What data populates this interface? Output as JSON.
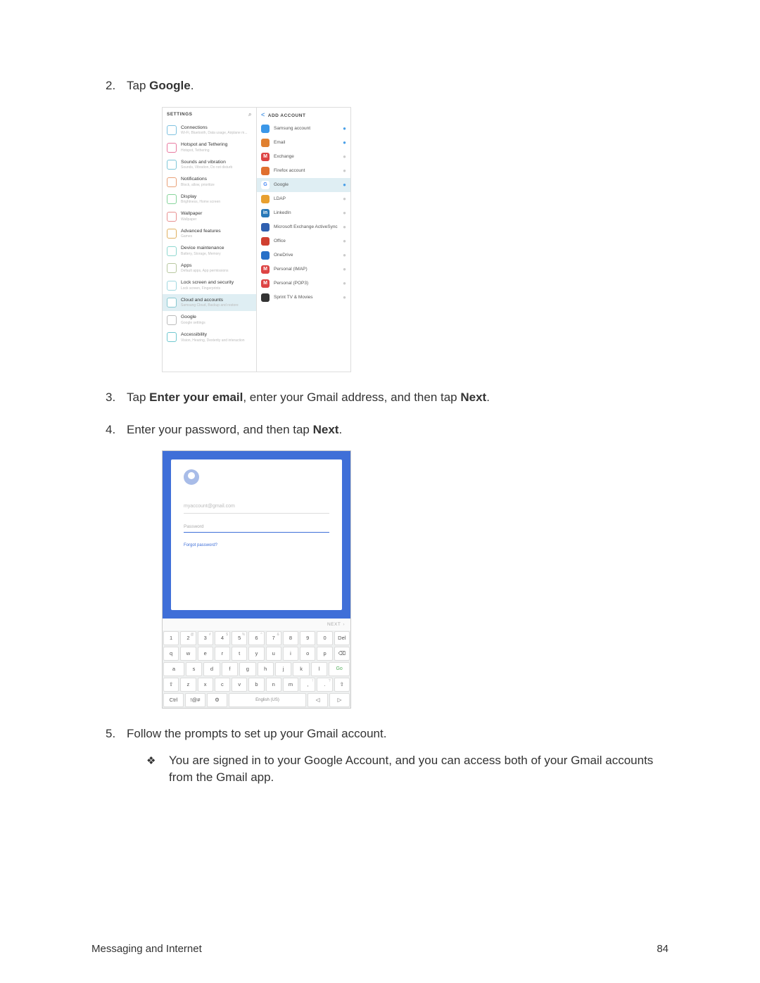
{
  "steps": {
    "s2": {
      "num": "2.",
      "pre": "Tap ",
      "bold": "Google",
      "post": "."
    },
    "s3": {
      "num": "3.",
      "pre": "Tap ",
      "b1": "Enter your email",
      "mid": ", enter your Gmail address, and then tap ",
      "b2": "Next",
      "post": "."
    },
    "s4": {
      "num": "4.",
      "pre": "Enter your password, and then tap ",
      "b1": "Next",
      "post": "."
    },
    "s5": {
      "num": "5.",
      "text": "Follow the prompts to set up your Gmail account."
    },
    "s5sub": "You are signed in to your Google Account, and you can access both of your Gmail accounts from the Gmail app."
  },
  "settings_left": {
    "title": "SETTINGS",
    "items": [
      {
        "t": "Connections",
        "s": "Wi-Fi, Bluetooth, Data usage, Airplane m...",
        "c": "#7fc2e0"
      },
      {
        "t": "Hotspot and Tethering",
        "s": "Hotspot, Tethering",
        "c": "#e97aa0"
      },
      {
        "t": "Sounds and vibration",
        "s": "Sounds, Vibration, Do not disturb",
        "c": "#7fc7d8"
      },
      {
        "t": "Notifications",
        "s": "Block, allow, prioritize",
        "c": "#e8a078"
      },
      {
        "t": "Display",
        "s": "Brightness, Home screen",
        "c": "#86d49b"
      },
      {
        "t": "Wallpaper",
        "s": "Wallpaper",
        "c": "#e89090"
      },
      {
        "t": "Advanced features",
        "s": "Games",
        "c": "#e0b060"
      },
      {
        "t": "Device maintenance",
        "s": "Battery, Storage, Memory",
        "c": "#8fd8d0"
      },
      {
        "t": "Apps",
        "s": "Default apps, App permissions",
        "c": "#b8c8a0"
      },
      {
        "t": "Lock screen and security",
        "s": "Lock screen, Fingerprints",
        "c": "#a0d8e0"
      },
      {
        "t": "Cloud and accounts",
        "s": "Samsung Cloud, Backup and restore",
        "c": "#88c8d0",
        "sel": true
      },
      {
        "t": "Google",
        "s": "Google settings",
        "c": "#bbb"
      },
      {
        "t": "Accessibility",
        "s": "Vision, Hearing, Dexterity and interaction",
        "c": "#70c8d0"
      }
    ]
  },
  "settings_right": {
    "title": "ADD ACCOUNT",
    "items": [
      {
        "t": "Samsung account",
        "c": "#3b97e8",
        "dot": "#4aa0e8"
      },
      {
        "t": "Email",
        "c": "#e08030",
        "dot": "#4aa0e8"
      },
      {
        "t": "Exchange",
        "c": "#d44",
        "dot": "#ccc",
        "g": "M"
      },
      {
        "t": "Firefox account",
        "c": "#e07030",
        "dot": "#ccc"
      },
      {
        "t": "Google",
        "c": "#fff",
        "dot": "#4aa0e8",
        "g": "G",
        "sel": true
      },
      {
        "t": "LDAP",
        "c": "#e8a030",
        "dot": "#ccc"
      },
      {
        "t": "LinkedIn",
        "c": "#2878b8",
        "dot": "#ccc",
        "g": "in"
      },
      {
        "t": "Microsoft Exchange ActiveSync",
        "c": "#3060b0",
        "dot": "#ccc"
      },
      {
        "t": "Office",
        "c": "#d04030",
        "dot": "#ccc"
      },
      {
        "t": "OneDrive",
        "c": "#2870c8",
        "dot": "#ccc"
      },
      {
        "t": "Personal (IMAP)",
        "c": "#d44",
        "dot": "#ccc",
        "g": "M"
      },
      {
        "t": "Personal (POP3)",
        "c": "#d44",
        "dot": "#ccc",
        "g": "M"
      },
      {
        "t": "Sprint TV & Movies",
        "c": "#333",
        "dot": "#ccc"
      }
    ]
  },
  "google": {
    "email": "myaccount@gmail.com",
    "pwd_placeholder": "Password",
    "forgot": "Forgot password?",
    "next": "NEXT"
  },
  "kb": {
    "row1": [
      [
        "1",
        ""
      ],
      [
        "2",
        "@"
      ],
      [
        "3",
        "#"
      ],
      [
        "4",
        "$"
      ],
      [
        "5",
        "%"
      ],
      [
        "6",
        "^"
      ],
      [
        "7",
        "&"
      ],
      [
        "8",
        ""
      ],
      [
        "9",
        ""
      ],
      [
        "0",
        ""
      ],
      [
        "Del",
        ""
      ]
    ],
    "row2": [
      [
        "q",
        ""
      ],
      [
        "w",
        ""
      ],
      [
        "e",
        ""
      ],
      [
        "r",
        ""
      ],
      [
        "t",
        ""
      ],
      [
        "y",
        ""
      ],
      [
        "u",
        ""
      ],
      [
        "i",
        ""
      ],
      [
        "o",
        ""
      ],
      [
        "p",
        ""
      ],
      [
        "⌫",
        ""
      ]
    ],
    "row3": [
      [
        "a",
        ""
      ],
      [
        "s",
        ""
      ],
      [
        "d",
        ""
      ],
      [
        "f",
        ""
      ],
      [
        "g",
        ""
      ],
      [
        "h",
        ""
      ],
      [
        "j",
        ""
      ],
      [
        "k",
        ""
      ],
      [
        "l",
        ""
      ],
      [
        "Go",
        ""
      ]
    ],
    "row4": [
      [
        "⇧",
        ""
      ],
      [
        "z",
        ""
      ],
      [
        "x",
        ""
      ],
      [
        "c",
        ""
      ],
      [
        "v",
        ""
      ],
      [
        "b",
        ""
      ],
      [
        "n",
        ""
      ],
      [
        "m",
        ""
      ],
      [
        ",",
        "!"
      ],
      [
        ".",
        "?"
      ],
      [
        "⇧",
        ""
      ]
    ],
    "row5": [
      [
        "Ctrl",
        ""
      ],
      [
        "!@#",
        ""
      ],
      [
        "⚙",
        ""
      ],
      [
        "English (US)",
        ""
      ],
      [
        "◁",
        ""
      ],
      [
        "▷",
        ""
      ]
    ]
  },
  "footer": {
    "left": "Messaging and Internet",
    "right": "84"
  }
}
